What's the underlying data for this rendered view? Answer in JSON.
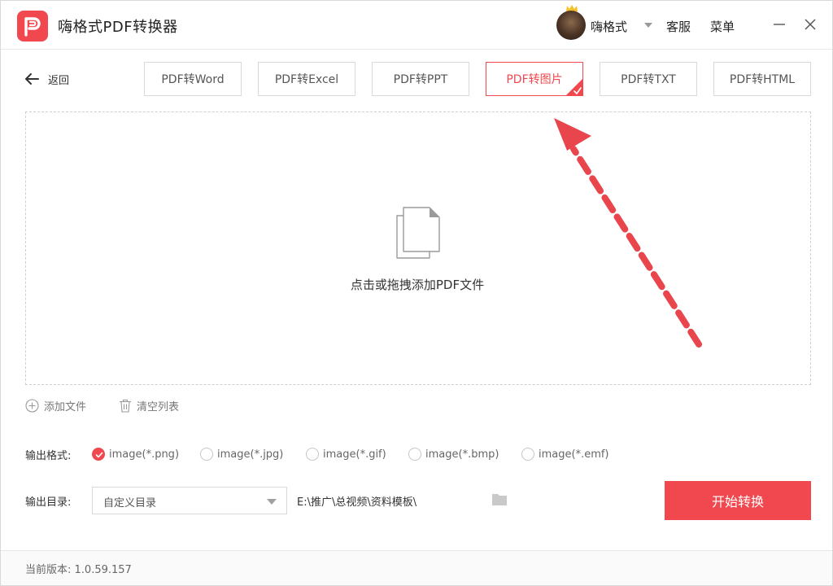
{
  "app": {
    "title": "嗨格式PDF转换器"
  },
  "header": {
    "username": "嗨格式",
    "service_label": "客服",
    "menu_label": "菜单"
  },
  "toolbar": {
    "back_label": "返回",
    "tabs": [
      {
        "label": "PDF转Word",
        "active": false
      },
      {
        "label": "PDF转Excel",
        "active": false
      },
      {
        "label": "PDF转PPT",
        "active": false
      },
      {
        "label": "PDF转图片",
        "active": true
      },
      {
        "label": "PDF转TXT",
        "active": false
      },
      {
        "label": "PDF转HTML",
        "active": false
      }
    ]
  },
  "dropzone": {
    "hint": "点击或拖拽添加PDF文件"
  },
  "list_actions": {
    "add_label": "添加文件",
    "clear_label": "清空列表"
  },
  "output_format": {
    "label": "输出格式:",
    "options": [
      {
        "label": "image(*.png)",
        "checked": true
      },
      {
        "label": "image(*.jpg)",
        "checked": false
      },
      {
        "label": "image(*.gif)",
        "checked": false
      },
      {
        "label": "image(*.bmp)",
        "checked": false
      },
      {
        "label": "image(*.emf)",
        "checked": false
      }
    ]
  },
  "output_dir": {
    "label": "输出目录:",
    "select_value": "自定义目录",
    "path": "E:\\推广\\总视频\\资料模板\\"
  },
  "start_button_label": "开始转换",
  "footer": {
    "version_label": "当前版本:",
    "version": "1.0.59.157"
  },
  "colors": {
    "accent": "#f0484e",
    "border": "#d9d9d9",
    "text": "#333333"
  }
}
